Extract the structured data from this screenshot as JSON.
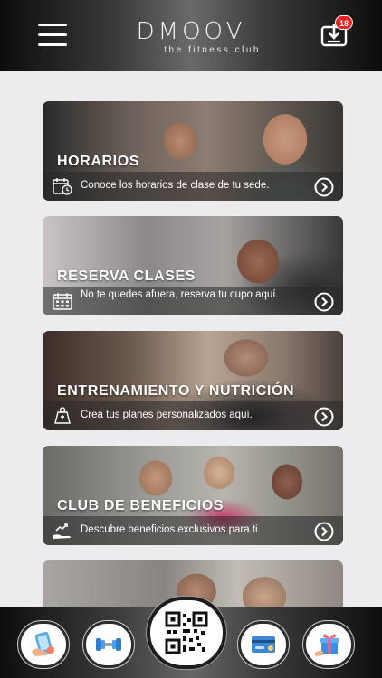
{
  "header": {
    "logo_main": "DMOOV",
    "logo_sub": "the fitness club",
    "notification_count": "18"
  },
  "cards": [
    {
      "title": "HORARIOS",
      "description": "Conoce los horarios de clase de tu sede.",
      "icon": "calendar-clock-icon"
    },
    {
      "title": "RESERVA CLASES",
      "description": "No te quedes afuera, reserva tu cupo aquí.",
      "icon": "calendar-grid-icon"
    },
    {
      "title": "ENTRENAMIENTO Y NUTRICIÓN",
      "description": "Crea tus planes personalizados aquí.",
      "icon": "weight-plate-icon"
    },
    {
      "title": "CLUB DE BENEFICIOS",
      "description": "Descubre beneficios exclusivos para ti.",
      "icon": "growth-hand-icon"
    }
  ],
  "bottom_nav": [
    {
      "name": "phone-hand-icon"
    },
    {
      "name": "dumbbell-icon"
    },
    {
      "name": "qr-code-icon"
    },
    {
      "name": "card-payment-icon"
    },
    {
      "name": "gift-icon"
    }
  ],
  "colors": {
    "badge": "#e52222",
    "background": "#ececee",
    "band": "rgba(40,40,40,.55)"
  }
}
